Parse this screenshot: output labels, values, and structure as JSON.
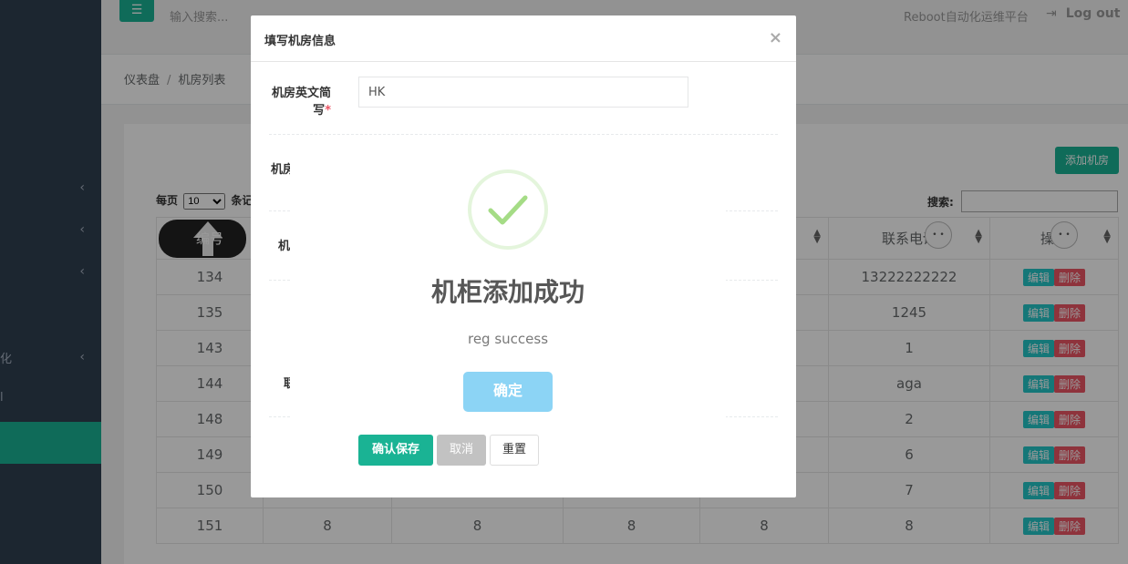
{
  "topbar": {
    "menu_icon": "☰",
    "search_placeholder": "输入搜索...",
    "brand": "Reboot自动化运维平台",
    "logout": "Log out"
  },
  "sidebar": {
    "fragments": [
      {
        "text": "化"
      },
      {
        "text": "l"
      }
    ]
  },
  "breadcrumb": {
    "home": "仪表盘",
    "separator": "/",
    "current": "机房列表"
  },
  "list": {
    "add_button": "添加机房",
    "per_page_label": "每页",
    "per_page_value": "10",
    "records_label": "条记",
    "search_label": "搜索:",
    "header_visible": {
      "id": "编号",
      "phone": "联系电话",
      "ops": "操作"
    },
    "rows": [
      {
        "id": "134",
        "phone": "13222222222"
      },
      {
        "id": "135",
        "phone": "1245"
      },
      {
        "id": "143",
        "phone": "1"
      },
      {
        "id": "144",
        "phone": "aga"
      },
      {
        "id": "148",
        "phone": "2"
      },
      {
        "id": "149",
        "phone": "6"
      },
      {
        "id": "150",
        "phone": "7"
      },
      {
        "id": "151",
        "c1": "8",
        "c2": "8",
        "c3": "8",
        "c4": "8",
        "phone": "8"
      }
    ],
    "edit_label": "编辑",
    "delete_label": "删除"
  },
  "form_modal": {
    "title": "填写机房信息",
    "close": "×",
    "label_en_name_line1": "机房英文简",
    "label_en_name_line2": "写",
    "required_mark": "*",
    "en_name_value": "HK",
    "label_partial_1": "机房",
    "label_partial_2": "机",
    "label_partial_3": "联",
    "save_button": "确认保存",
    "cancel_button": "取消",
    "reset_button": "重置"
  },
  "alert": {
    "title": "机柜添加成功",
    "text": "reg success",
    "confirm_button": "确定",
    "accent": "#8cd4f5",
    "check_color": "#a5dc86"
  },
  "colors": {
    "sidebar": "#2f4050",
    "primary": "#1ab394",
    "edit": "#23c6c8",
    "delete": "#ed5565"
  }
}
